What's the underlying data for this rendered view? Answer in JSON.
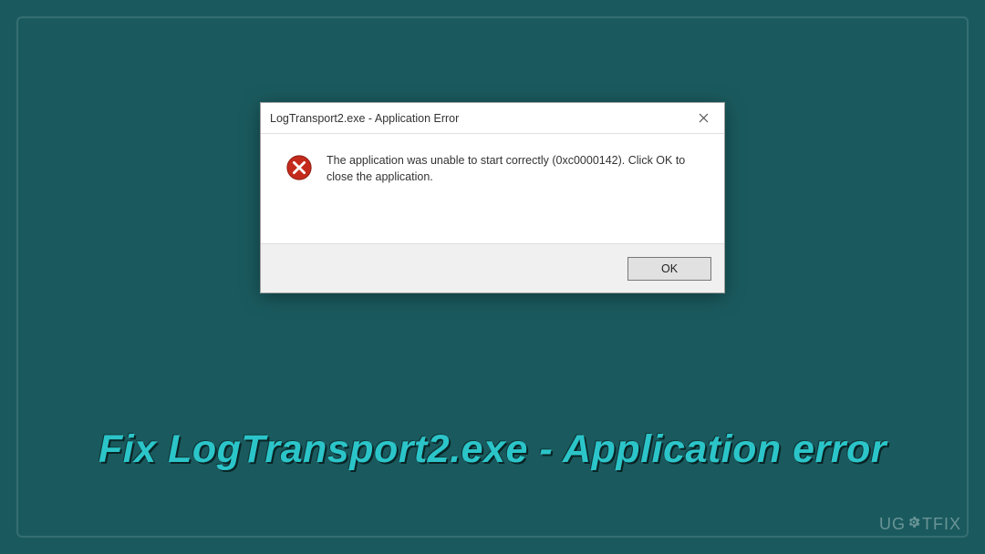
{
  "dialog": {
    "title": "LogTransport2.exe - Application Error",
    "message": "The application was unable to start correctly (0xc0000142). Click OK to close the application.",
    "ok_label": "OK"
  },
  "headline": "Fix LogTransport2.exe - Application error",
  "watermark": {
    "prefix": "UG",
    "suffix": "TFIX"
  },
  "colors": {
    "background": "#1a5a5e",
    "accent": "#2bc5c9",
    "error_red": "#c42b1c"
  }
}
